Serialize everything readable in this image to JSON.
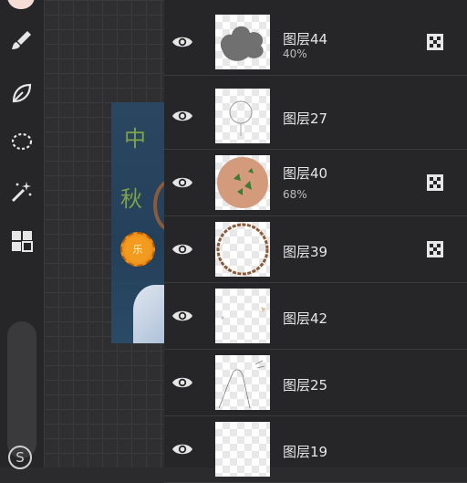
{
  "sidebar": {
    "tools": [
      {
        "icon": "brush-icon"
      },
      {
        "icon": "eraser-leaf-icon"
      },
      {
        "icon": "lasso-icon"
      },
      {
        "icon": "magic-wand-icon"
      },
      {
        "icon": "layers-grid-icon"
      }
    ],
    "bottom_button": "S"
  },
  "artwork": {
    "char1": "中",
    "char2": "秋",
    "mooncake_text": "乐"
  },
  "layers": [
    {
      "name": "图层44",
      "opacity": "40%",
      "thumb": "gray-cloud",
      "blend": true
    },
    {
      "name": "图层27",
      "opacity": "",
      "thumb": "sketch-circle",
      "blend": false
    },
    {
      "name": "图层40",
      "opacity": "68%",
      "thumb": "leaf-circle",
      "blend": true
    },
    {
      "name": "图层39",
      "opacity": "",
      "thumb": "ring",
      "blend": true
    },
    {
      "name": "图层42",
      "opacity": "",
      "thumb": "small-marks",
      "blend": false
    },
    {
      "name": "图层25",
      "opacity": "",
      "thumb": "line-sketch",
      "blend": false
    },
    {
      "name": "图层19",
      "opacity": "",
      "thumb": "empty",
      "blend": false
    }
  ]
}
